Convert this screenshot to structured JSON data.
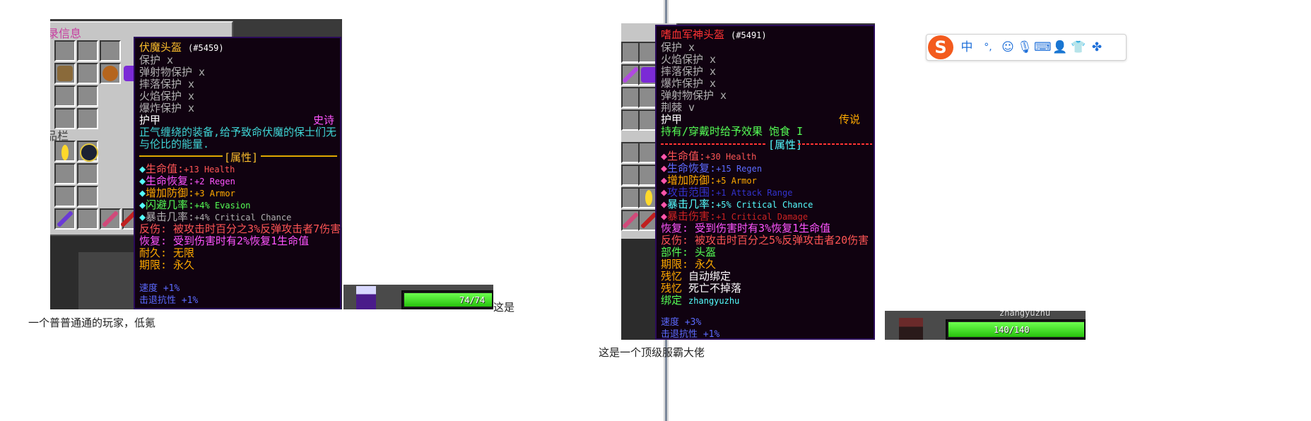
{
  "left": {
    "inventory_title": "录信息",
    "inventory_sub": "品栏",
    "tooltip": {
      "name": "伏魔头盔",
      "id": "(#5459)",
      "protections": [
        {
          "label": "保护",
          "mark": "x"
        },
        {
          "label": "弹射物保护",
          "mark": "x"
        },
        {
          "label": "摔落保护",
          "mark": "x"
        },
        {
          "label": "火焰保护",
          "mark": "x"
        },
        {
          "label": "爆炸保护",
          "mark": "x"
        }
      ],
      "armor_label": "护甲",
      "rarity": "史诗",
      "lore_1": "正气缠绕的装备,给予致命伏魔的保士们无",
      "lore_2": "与伦比的能量.",
      "attr_header": "[属性]",
      "stats": [
        {
          "label": "生命值:",
          "value": "+13 Health",
          "color": "#ff5555"
        },
        {
          "label": "生命恢复:",
          "value": "+2 Regen",
          "color": "#ff55ff"
        },
        {
          "label": "增加防御:",
          "value": "+3 Armor",
          "color": "#ffaa00"
        },
        {
          "label": "闪避几率:",
          "value": "+4% Evasion",
          "color": "#55ff55"
        },
        {
          "label": "暴击几率:",
          "value": "+4% Critical Chance",
          "color": "#b0b0b0"
        }
      ],
      "effects": [
        {
          "text": "反伤: 被攻击时百分之3%反弹攻击者7伤害",
          "color": "#ff5555"
        },
        {
          "text": "恢复: 受到伤害时有2%恢复1生命值",
          "color": "#ff55ff"
        },
        {
          "text": "耐久: 无限",
          "color": "#ffaa00"
        },
        {
          "text": "期限: 永久",
          "color": "#ffaa00"
        }
      ],
      "speed": "速度 +1%",
      "knockback": "击退抗性 +1%"
    },
    "health": "74/74",
    "caption_end": "这是",
    "caption_line2": "一个普普通通的玩家，低氪"
  },
  "right": {
    "tooltip": {
      "name": "嗜血军神头盔",
      "id": "(#5491)",
      "protections": [
        {
          "label": "保护",
          "mark": "x"
        },
        {
          "label": "火焰保护",
          "mark": "x"
        },
        {
          "label": "摔落保护",
          "mark": "x"
        },
        {
          "label": "爆炸保护",
          "mark": "x"
        },
        {
          "label": "弹射物保护",
          "mark": "x"
        },
        {
          "label": "荆棘",
          "mark": "v"
        }
      ],
      "armor_label": "护甲",
      "rarity": "传说",
      "hold_effect": "持有/穿戴时给予效果 饱食 I",
      "attr_header": "[属性]",
      "stats": [
        {
          "label": "生命值:",
          "value": "+30 Health",
          "color": "#ff5555"
        },
        {
          "label": "生命恢复:",
          "value": "+15 Regen",
          "color": "#5c6bff"
        },
        {
          "label": "增加防御:",
          "value": "+5 Armor",
          "color": "#ffaa00"
        },
        {
          "label": "攻击范围:",
          "value": "+1 Attack Range",
          "color": "#3333cc"
        },
        {
          "label": "暴击几率:",
          "value": "+5% Critical Chance",
          "color": "#55ffff"
        },
        {
          "label": "暴击伤害:",
          "value": "+1 Critical Damage",
          "color": "#cc2222"
        }
      ],
      "effects": [
        {
          "text": "恢复: 受到伤害时有3%恢复1生命值",
          "color": "#ff55ff"
        },
        {
          "text": "反伤: 被攻击时百分之5%反弹攻击者20伤害",
          "color": "#ff5555"
        },
        {
          "text": "部件: 头盔",
          "color": "#55ff55"
        },
        {
          "text": "期限: 永久",
          "color": "#ffaa00"
        }
      ],
      "memory_1_label": "残忆",
      "memory_1": "自动绑定",
      "memory_2_label": "残忆",
      "memory_2": "死亡不掉落",
      "bind_label": "绑定",
      "bind_value": "zhangyuzhu",
      "speed": "速度 +3%",
      "knockback": "击退抗性 +1%"
    },
    "player_name": "zhangyuzhu",
    "health": "140/140",
    "caption": "这是一个顶级服霸大佬"
  },
  "ime": {
    "logo": "S",
    "lang": "中",
    "punct": "°,",
    "icons": [
      "emoji-icon",
      "mic-icon",
      "keyboard-icon",
      "user-icon",
      "skin-icon",
      "apps-icon"
    ]
  }
}
